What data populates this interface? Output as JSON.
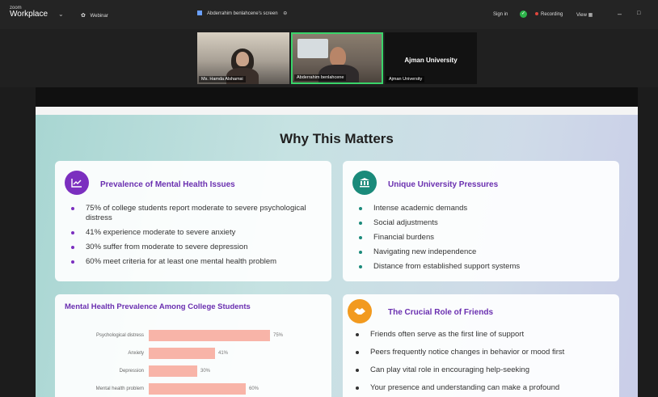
{
  "app": {
    "brand_top": "zoom",
    "brand_bottom": "Workplace",
    "webinar_label": "Webinar",
    "share_label": "Abderrahim benlahcene's screen",
    "sign_in": "Sign in",
    "recording": "Recording",
    "view": "View"
  },
  "participants": [
    {
      "name": "Ms. Hamda Alshamsi"
    },
    {
      "name": "Abderrahim benlahcene"
    },
    {
      "name": "Ajman University",
      "title": "Ajman University"
    }
  ],
  "slide": {
    "title": "Why This Matters",
    "card1": {
      "heading": "Prevalence of Mental Health Issues",
      "icon": "chart-line-icon",
      "color": "#7b2fbf",
      "items": [
        "75% of college students report moderate to severe psychological distress",
        "41% experience moderate to severe anxiety",
        "30% suffer from moderate to severe depression",
        "60% meet criteria for at least one mental health problem"
      ]
    },
    "card2": {
      "heading": "Unique University Pressures",
      "icon": "university-icon",
      "color": "#1a8a7a",
      "items": [
        "Intense academic demands",
        "Social adjustments",
        "Financial burdens",
        "Navigating new independence",
        "Distance from established support systems"
      ]
    },
    "card3": {
      "heading": "Mental Health Prevalence Among College Students"
    },
    "card4": {
      "heading": "The Crucial Role of Friends",
      "icon": "handshake-icon",
      "color": "#f29a1f",
      "items": [
        "Friends often serve as the first line of support",
        "Peers frequently notice changes in behavior or mood first",
        "Can play vital role in encouraging help-seeking",
        "Your presence and understanding can make a profound"
      ]
    }
  },
  "chart_data": {
    "type": "bar",
    "orientation": "horizontal",
    "title": "Mental Health Prevalence Among College Students",
    "categories": [
      "Psychological distress",
      "Anxiety",
      "Depression",
      "Mental health problem"
    ],
    "values": [
      75,
      41,
      30,
      60
    ],
    "value_labels": [
      "75%",
      "41%",
      "30%",
      "60%"
    ],
    "xlim": [
      0,
      100
    ],
    "bar_color": "#f8b4a8"
  }
}
